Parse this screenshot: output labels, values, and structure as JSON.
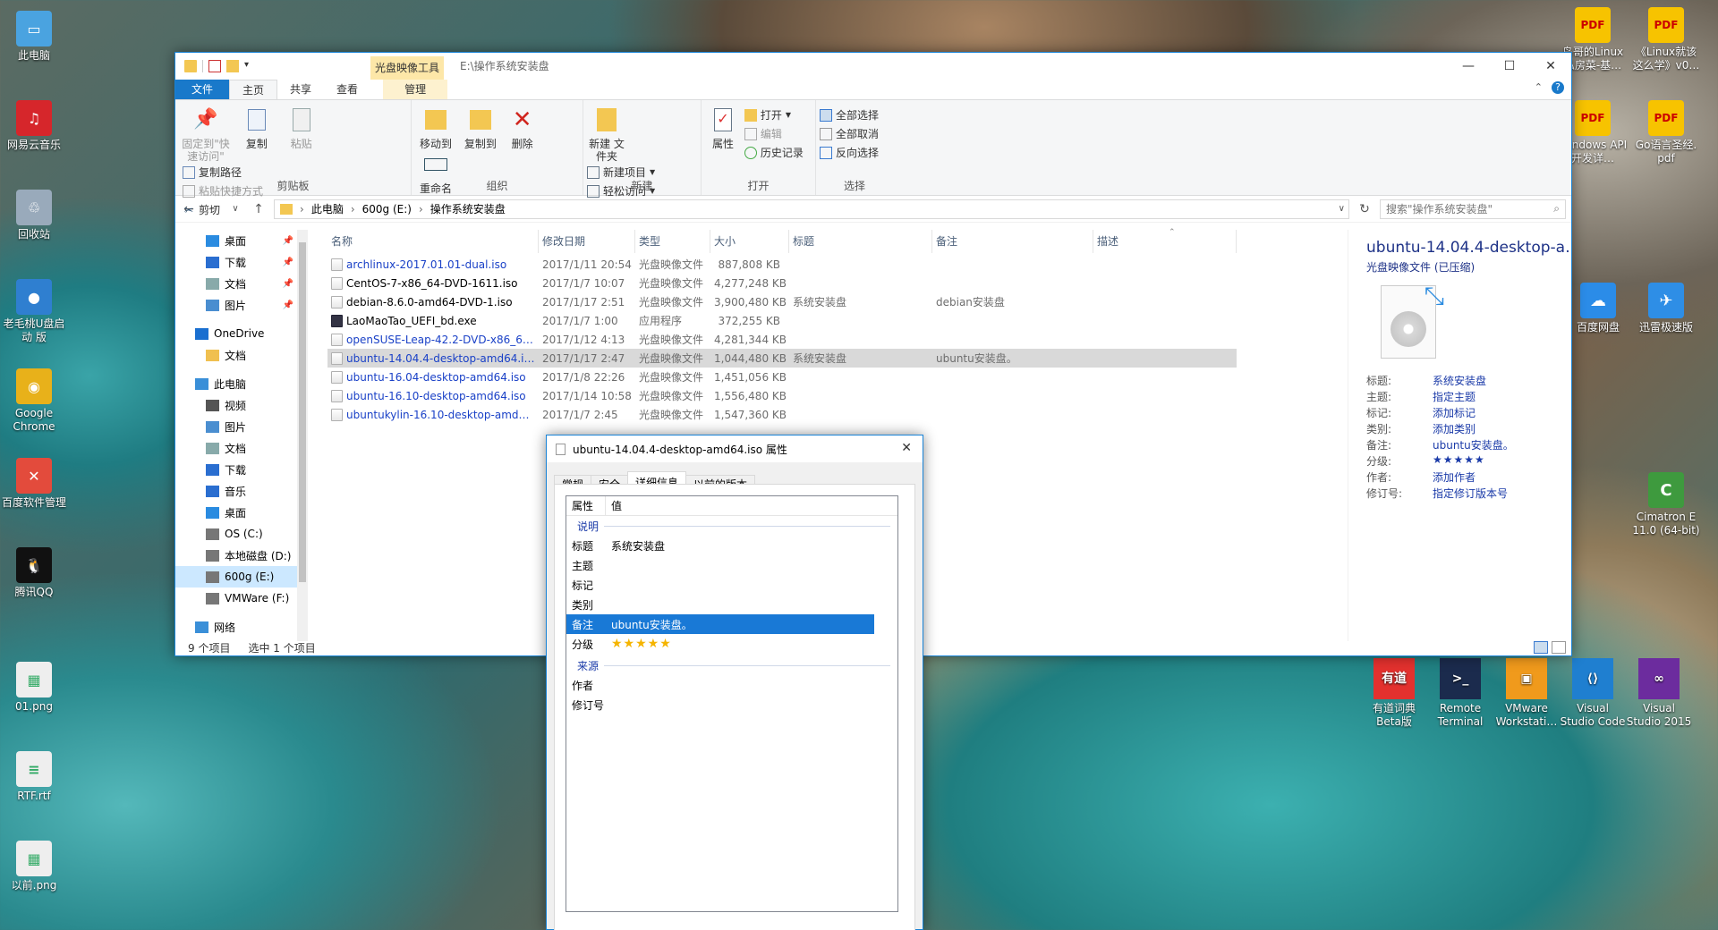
{
  "desktop_left": [
    {
      "label": "此电脑",
      "icon": "computer-icon",
      "color": "#4aa3e0",
      "glyph": "▭"
    },
    {
      "label": "网易云音乐",
      "icon": "netease-music-icon",
      "color": "#d6262b",
      "glyph": "♫"
    },
    {
      "label": "回收站",
      "icon": "recycle-bin-icon",
      "color": "#9ab",
      "glyph": "♲"
    },
    {
      "label": "老毛桃U盘启动 版",
      "icon": "laomaotao-icon",
      "color": "#2f7fd0",
      "glyph": "●"
    },
    {
      "label": "Google Chrome",
      "icon": "chrome-icon",
      "color": "#e8b11a",
      "glyph": "◉"
    },
    {
      "label": "百度软件管理",
      "icon": "baidu-software-icon",
      "color": "#e34b3c",
      "glyph": "✕"
    },
    {
      "label": "腾讯QQ",
      "icon": "qq-icon",
      "color": "#111",
      "glyph": "🐧"
    },
    {
      "label": "01.png",
      "icon": "png-file-icon",
      "color": "#eee",
      "glyph": "▦"
    },
    {
      "label": "RTF.rtf",
      "icon": "rtf-file-icon",
      "color": "#eee",
      "glyph": "≡"
    },
    {
      "label": "以前.png",
      "icon": "png-file-icon",
      "color": "#eee",
      "glyph": "▦"
    }
  ],
  "desktop_right": [
    {
      "label": "鸟哥的Linux 私房菜-基…",
      "icon": "pdf-icon",
      "color": "#f7c300",
      "glyph": "PDF"
    },
    {
      "label": "《Linux就该 这么学》v0…",
      "icon": "pdf-icon",
      "color": "#f7c300",
      "glyph": "PDF"
    },
    {
      "label": "Windows API开发详…",
      "icon": "pdf-icon",
      "color": "#f7c300",
      "glyph": "PDF"
    },
    {
      "label": "Go语言圣经. pdf",
      "icon": "pdf-icon",
      "color": "#f7c300",
      "glyph": "PDF"
    },
    {
      "label": "百度网盘",
      "icon": "baidu-netdisk-icon",
      "color": "#2b8ce8",
      "glyph": "☁"
    },
    {
      "label": "迅雷极速版",
      "icon": "xunlei-icon",
      "color": "#2e8ee6",
      "glyph": "✈"
    },
    {
      "label": "Cimatron E 11.0 (64-bit)",
      "icon": "cimatron-icon",
      "color": "#3e9a3e",
      "glyph": "C"
    }
  ],
  "taskbar_tiles": [
    {
      "label": "有道词典 Beta版",
      "icon": "youdao-icon",
      "color": "#e3312e",
      "glyph": "有道"
    },
    {
      "label": "Remote Terminal",
      "icon": "terminal-icon",
      "color": "#1b2b4d",
      "glyph": ">_"
    },
    {
      "label": "VMware Workstati…",
      "icon": "vmware-icon",
      "color": "#f09a1c",
      "glyph": "▣"
    },
    {
      "label": "Visual Studio Code",
      "icon": "vscode-icon",
      "color": "#1f7fd0",
      "glyph": "⟨⟩"
    },
    {
      "label": "Visual Studio 2015",
      "icon": "visual-studio-icon",
      "color": "#6c2c9e",
      "glyph": "∞"
    }
  ],
  "explorer": {
    "context_tab": "光盘映像工具",
    "title": "E:\\操作系统安装盘",
    "tabs": [
      "文件",
      "主页",
      "共享",
      "查看",
      "管理"
    ],
    "ribbon": {
      "clipboard": {
        "pin": "固定到\"快速访问\"",
        "copy": "复制",
        "paste": "粘贴",
        "copy_path": "复制路径",
        "paste_shortcut": "粘贴快捷方式",
        "cut": "剪切",
        "label": "剪贴板"
      },
      "organize": {
        "move": "移动到",
        "copy_to": "复制到",
        "delete": "删除",
        "rename": "重命名",
        "label": "组织"
      },
      "new": {
        "folder": "新建 文件夹",
        "item": "新建项目",
        "easy": "轻松访问",
        "label": "新建"
      },
      "open": {
        "props": "属性",
        "open": "打开",
        "edit": "编辑",
        "history": "历史记录",
        "label": "打开"
      },
      "select": {
        "all": "全部选择",
        "none": "全部取消",
        "invert": "反向选择",
        "label": "选择"
      }
    },
    "address": {
      "this_pc": "此电脑",
      "drive": "600g (E:)",
      "folder": "操作系统安装盘"
    },
    "search_placeholder": "搜索\"操作系统安装盘\"",
    "nav": [
      {
        "label": "桌面",
        "icon": "desktop-icon",
        "pin": true,
        "color": "#2a8be0"
      },
      {
        "label": "下载",
        "icon": "download-icon",
        "pin": true,
        "color": "#2a6ed0"
      },
      {
        "label": "文档",
        "icon": "documents-icon",
        "pin": true,
        "color": "#8aa"
      },
      {
        "label": "图片",
        "icon": "pictures-icon",
        "pin": true,
        "color": "#4a8ed0"
      },
      {
        "label": "",
        "icon": "",
        "pin": false,
        "color": ""
      },
      {
        "label": "OneDrive",
        "icon": "onedrive-icon",
        "pin": false,
        "color": "#1a6fd0"
      },
      {
        "label": "文档",
        "icon": "folder-icon",
        "pin": false,
        "color": "#f0c050"
      },
      {
        "label": "",
        "icon": "",
        "pin": false,
        "color": ""
      },
      {
        "label": "此电脑",
        "icon": "computer-icon",
        "pin": false,
        "color": "#3a8fd8"
      },
      {
        "label": "视频",
        "icon": "videos-icon",
        "pin": false,
        "color": "#555"
      },
      {
        "label": "图片",
        "icon": "pictures-icon",
        "pin": false,
        "color": "#4a8ed0"
      },
      {
        "label": "文档",
        "icon": "documents-icon",
        "pin": false,
        "color": "#8aa"
      },
      {
        "label": "下载",
        "icon": "download-icon",
        "pin": false,
        "color": "#2a6ed0"
      },
      {
        "label": "音乐",
        "icon": "music-icon",
        "pin": false,
        "color": "#2a6ed0"
      },
      {
        "label": "桌面",
        "icon": "desktop-icon",
        "pin": false,
        "color": "#2a8be0"
      },
      {
        "label": "OS (C:)",
        "icon": "drive-icon",
        "pin": false,
        "color": "#777"
      },
      {
        "label": "本地磁盘 (D:)",
        "icon": "drive-icon",
        "pin": false,
        "color": "#777"
      },
      {
        "label": "600g (E:)",
        "icon": "drive-icon",
        "pin": false,
        "color": "#777",
        "selected": true
      },
      {
        "label": "VMWare (F:)",
        "icon": "drive-icon",
        "pin": false,
        "color": "#777"
      },
      {
        "label": "",
        "icon": "",
        "pin": false,
        "color": ""
      },
      {
        "label": "网络",
        "icon": "network-icon",
        "pin": false,
        "color": "#3a8fd8"
      }
    ],
    "columns": [
      "名称",
      "修改日期",
      "类型",
      "大小",
      "标题",
      "备注",
      "描述"
    ],
    "files": [
      {
        "name": "archlinux-2017.01.01-dual.iso",
        "date": "2017/1/11 20:54",
        "type": "光盘映像文件",
        "size": "887,808 KB",
        "title": "",
        "note": "",
        "blue": true
      },
      {
        "name": "CentOS-7-x86_64-DVD-1611.iso",
        "date": "2017/1/7 10:07",
        "type": "光盘映像文件",
        "size": "4,277,248 KB",
        "title": "",
        "note": "",
        "blue": false
      },
      {
        "name": "debian-8.6.0-amd64-DVD-1.iso",
        "date": "2017/1/17 2:51",
        "type": "光盘映像文件",
        "size": "3,900,480 KB",
        "title": "系统安装盘",
        "note": "debian安装盘",
        "blue": false
      },
      {
        "name": "LaoMaoTao_UEFI_bd.exe",
        "date": "2017/1/7 1:00",
        "type": "应用程序",
        "size": "372,255 KB",
        "title": "",
        "note": "",
        "blue": false
      },
      {
        "name": "openSUSE-Leap-42.2-DVD-x86_6…",
        "date": "2017/1/12 4:13",
        "type": "光盘映像文件",
        "size": "4,281,344 KB",
        "title": "",
        "note": "",
        "blue": true
      },
      {
        "name": "ubuntu-14.04.4-desktop-amd64.i…",
        "date": "2017/1/17 2:47",
        "type": "光盘映像文件",
        "size": "1,044,480 KB",
        "title": "系统安装盘",
        "note": "ubuntu安装盘。",
        "blue": true,
        "selected": true
      },
      {
        "name": "ubuntu-16.04-desktop-amd64.iso",
        "date": "2017/1/8 22:26",
        "type": "光盘映像文件",
        "size": "1,451,056 KB",
        "title": "",
        "note": "",
        "blue": true
      },
      {
        "name": "ubuntu-16.10-desktop-amd64.iso",
        "date": "2017/1/14 10:58",
        "type": "光盘映像文件",
        "size": "1,556,480 KB",
        "title": "",
        "note": "",
        "blue": true
      },
      {
        "name": "ubuntukylin-16.10-desktop-amd…",
        "date": "2017/1/7 2:45",
        "type": "光盘映像文件",
        "size": "1,547,360 KB",
        "title": "",
        "note": "",
        "blue": true
      }
    ],
    "details": {
      "title": "ubuntu-14.04.4-desktop-a…",
      "subtitle": "光盘映像文件 (已压缩)",
      "props": [
        {
          "k": "标题:",
          "v": "系统安装盘"
        },
        {
          "k": "主题:",
          "v": "指定主题"
        },
        {
          "k": "标记:",
          "v": "添加标记"
        },
        {
          "k": "类别:",
          "v": "添加类别"
        },
        {
          "k": "备注:",
          "v": "ubuntu安装盘。"
        },
        {
          "k": "分级:",
          "v": "★★★★★"
        },
        {
          "k": "作者:",
          "v": "添加作者"
        },
        {
          "k": "修订号:",
          "v": "指定修订版本号"
        }
      ]
    },
    "status": {
      "count": "9 个项目",
      "selected": "选中 1 个项目"
    }
  },
  "dialog": {
    "title": "ubuntu-14.04.4-desktop-amd64.iso 属性",
    "tabs": [
      "常规",
      "安全",
      "详细信息",
      "以前的版本"
    ],
    "col_prop": "属性",
    "col_val": "值",
    "sec_desc": "说明",
    "sec_src": "来源",
    "rows_desc": [
      {
        "k": "标题",
        "v": "系统安装盘"
      },
      {
        "k": "主题",
        "v": ""
      },
      {
        "k": "标记",
        "v": ""
      },
      {
        "k": "类别",
        "v": ""
      },
      {
        "k": "备注",
        "v": "ubuntu安装盘。",
        "hl": true
      },
      {
        "k": "分级",
        "v": "★★★★★",
        "stars": true
      }
    ],
    "rows_src": [
      {
        "k": "作者",
        "v": ""
      },
      {
        "k": "修订号",
        "v": ""
      }
    ]
  }
}
